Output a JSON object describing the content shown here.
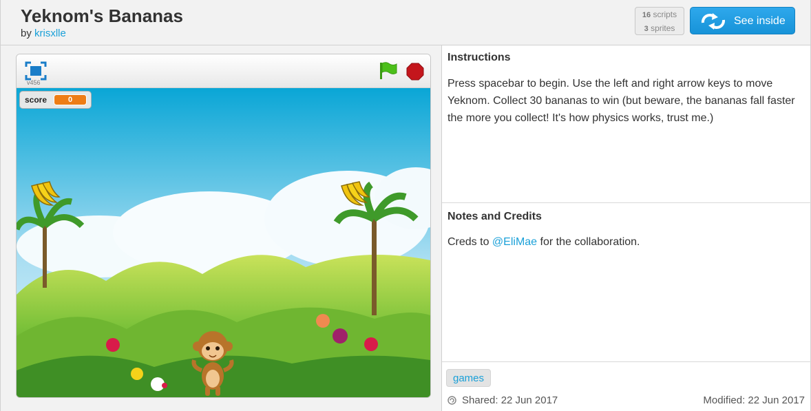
{
  "project": {
    "title": "Yeknom's Bananas",
    "by_prefix": "by",
    "author": "krisxlle",
    "scripts_count": "16",
    "scripts_label": "scripts",
    "sprites_count": "3",
    "sprites_label": "sprites",
    "see_inside_label": "See inside"
  },
  "player": {
    "version": "v456",
    "score_label": "score",
    "score_value": "0"
  },
  "instructions": {
    "heading": "Instructions",
    "text": "Press spacebar to begin. Use the left and right arrow keys to move Yeknom. Collect 30 bananas to win (but beware, the bananas fall faster the more you collect! It's how physics works, trust me.)"
  },
  "notes": {
    "heading": "Notes and Credits",
    "prefix": "Creds to ",
    "mention": "@EliMae",
    "suffix": " for the collaboration."
  },
  "footer": {
    "tag": "games",
    "shared": "Shared: 22 Jun 2017",
    "modified": "Modified: 22 Jun 2017"
  },
  "colors": {
    "link": "#1aa0d8",
    "button": "#1793d8",
    "score_orange": "#ee7d16",
    "flag_green": "#4cbf1a",
    "stop_red": "#c4161c",
    "sky_top": "#0aa6d6"
  },
  "icons": [
    "fullscreen-icon",
    "green-flag-icon",
    "stop-icon",
    "see-inside-arrows-icon",
    "share-icon"
  ]
}
